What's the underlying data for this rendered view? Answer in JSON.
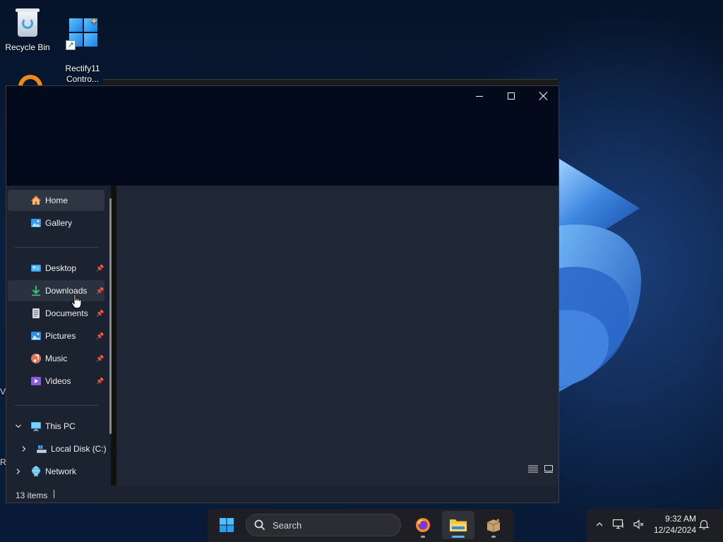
{
  "desktop": {
    "icons": [
      {
        "label": "Recycle Bin"
      },
      {
        "label": "Rectify11\nContro..."
      }
    ],
    "clipped_left_letters": [
      "V",
      "R"
    ]
  },
  "explorer": {
    "caption": {
      "minimize": "Minimize",
      "maximize": "Maximize",
      "close": "Close"
    },
    "nav": {
      "top": [
        {
          "label": "Home",
          "icon": "home-icon"
        },
        {
          "label": "Gallery",
          "icon": "gallery-icon"
        }
      ],
      "quick_access": [
        {
          "label": "Desktop",
          "icon": "desktop-folder-icon",
          "pinned": true
        },
        {
          "label": "Downloads",
          "icon": "download-icon",
          "pinned": true
        },
        {
          "label": "Documents",
          "icon": "documents-icon",
          "pinned": true
        },
        {
          "label": "Pictures",
          "icon": "pictures-icon",
          "pinned": true
        },
        {
          "label": "Music",
          "icon": "music-icon",
          "pinned": true
        },
        {
          "label": "Videos",
          "icon": "videos-icon",
          "pinned": true
        }
      ],
      "tree": [
        {
          "label": "This PC",
          "icon": "this-pc-icon",
          "expanded": true
        },
        {
          "label": "Local Disk (C:)",
          "icon": "drive-icon",
          "expanded": false
        },
        {
          "label": "Network",
          "icon": "network-icon",
          "expanded": false
        }
      ],
      "selected": "Home",
      "hovered": "Downloads"
    },
    "status": {
      "items": "13 items"
    }
  },
  "taskbar": {
    "search_placeholder": "Search",
    "apps": [
      {
        "name": "start",
        "icon": "windows-logo-icon"
      },
      {
        "name": "firefox",
        "icon": "firefox-icon",
        "running": true
      },
      {
        "name": "file-explorer",
        "icon": "file-explorer-icon",
        "active": true
      },
      {
        "name": "package",
        "icon": "package-icon",
        "running": true
      }
    ],
    "clock": {
      "time": "9:32 AM",
      "date": "12/24/2024"
    }
  },
  "colors": {
    "accent": "#5fb2f5",
    "titlebar": "#020a1b",
    "content": "#1f2735",
    "taskbar": "#1d1f24"
  }
}
